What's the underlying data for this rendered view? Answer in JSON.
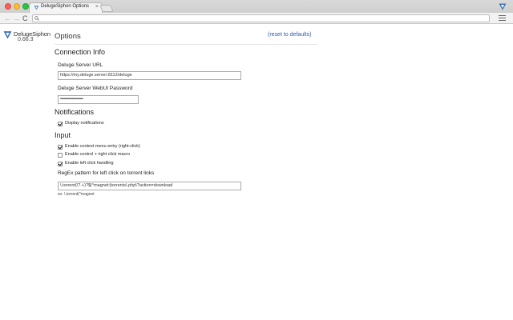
{
  "browser": {
    "tab_title": "DelugeSiphon Options",
    "tab_close": "×",
    "address": "",
    "back_glyph": "←",
    "forward_glyph": "→",
    "reload_glyph": "C"
  },
  "brand": {
    "name": "DelugeSiphon",
    "version": "0.66.3"
  },
  "page": {
    "title": "Options",
    "reset_label": "(reset to defaults)"
  },
  "connection": {
    "heading": "Connection Info",
    "server_url_label": "Deluge Server URL",
    "server_url_value": "https://my.deluge.server:8112/deluge",
    "password_label": "Deluge Server WebUI Password",
    "password_value": "••••••••••••••••••••"
  },
  "notifications": {
    "heading": "Notifications",
    "display_label": "Display notifications",
    "display_checked": true
  },
  "input": {
    "heading": "Input",
    "context_menu_label": "Enable context menu entry (right-click)",
    "context_menu_checked": true,
    "control_right_label": "Enable control + right click macro",
    "control_right_checked": false,
    "left_click_label": "Enable left click handling",
    "left_click_checked": true,
    "regex_label": "RegEx pattern for left click on torrent links",
    "regex_value": "\\.torrent(\\?.+)?$|^magnet:|torrents\\.php\\?action=download",
    "regex_hint": "ex: \\.torrent|^magnet"
  },
  "colors": {
    "link": "#2a5db0",
    "brand_logo": "#3b6fb6"
  }
}
